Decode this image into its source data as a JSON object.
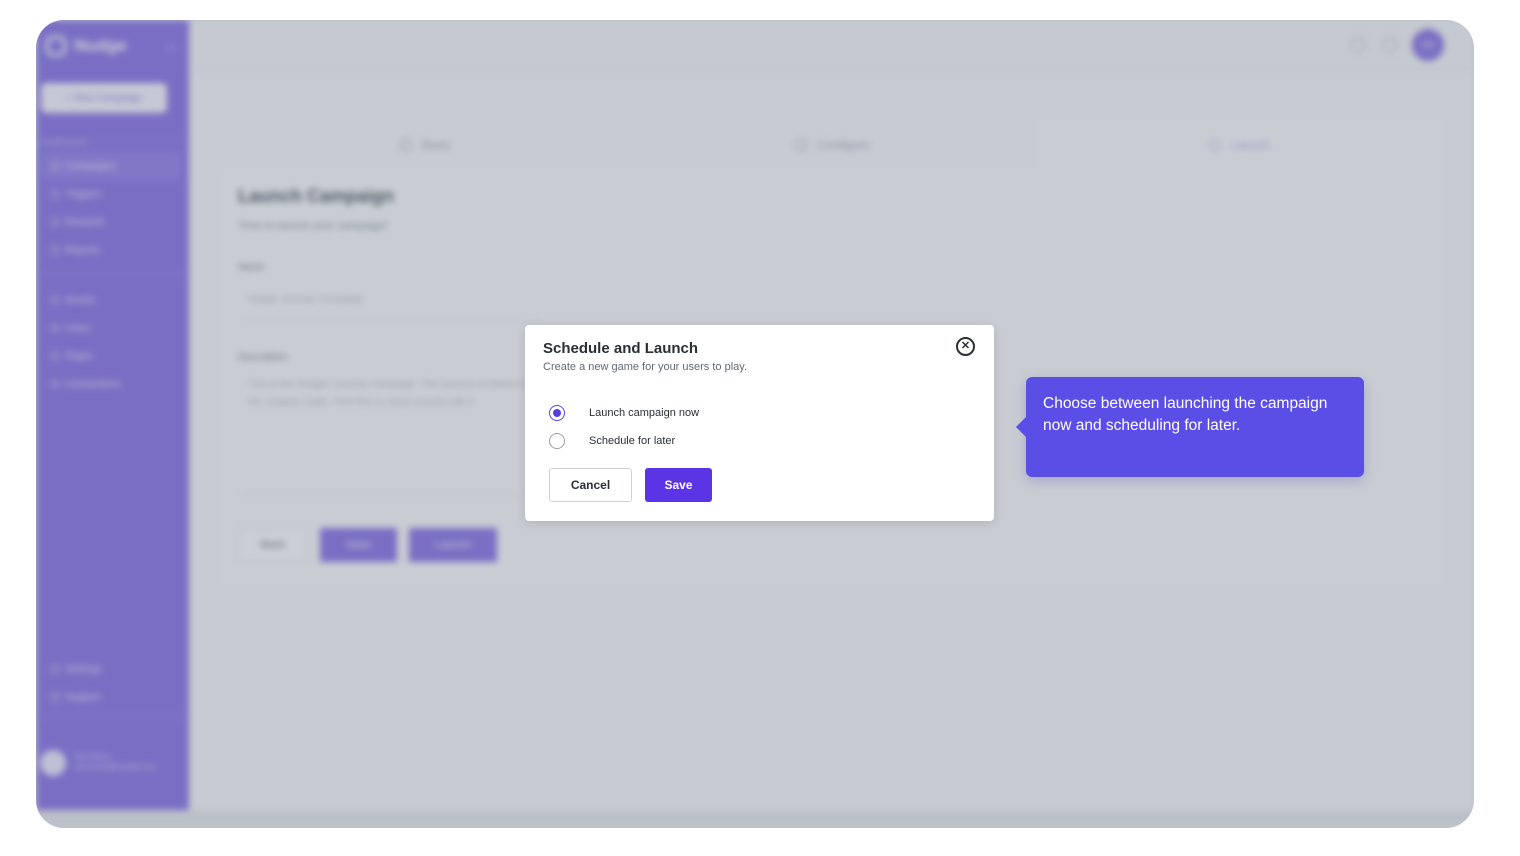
{
  "app": {
    "logo_text": "Nudge",
    "new_button": "+ New Campaign",
    "section_main": "CAMPAIGNS",
    "nav_main": [
      "Campaigns",
      "Triggers",
      "Rewards",
      "Reports"
    ],
    "nav_secondary": [
      "Assets",
      "Users",
      "Pages",
      "Connections"
    ],
    "nav_bottom": [
      "Settings",
      "Support"
    ],
    "user_name": "Nina Rivera",
    "user_email": "nina.rivera@example.com",
    "top_avatar": "NR"
  },
  "steps": [
    "Basic",
    "Configure",
    "Launch"
  ],
  "form": {
    "title": "Launch Campaign",
    "subtitle": "Time to launch your campaign!",
    "name_label": "Name",
    "name_value": "Nudge Journey Campaign",
    "description_label": "Description",
    "description_value": "This is the Nudges Journey campaign. This journey is linked to the rewards made. Feel free to move around with it.",
    "back_label": "Back",
    "save_label": "Save",
    "launch_label": "Launch"
  },
  "modal": {
    "title": "Schedule and Launch",
    "subtitle": "Create a new game for your users to play.",
    "close_icon": "close-icon",
    "options": [
      {
        "label": "Launch campaign now",
        "checked": true
      },
      {
        "label": "Schedule for later",
        "checked": false
      }
    ],
    "cancel_label": "Cancel",
    "save_label": "Save"
  },
  "tooltip": {
    "text": "Choose between launching the campaign now and scheduling for later."
  },
  "colors": {
    "brand": "#6b4fe0",
    "primary_button": "#5b34e6",
    "tooltip_bg": "#5b4ee6"
  }
}
